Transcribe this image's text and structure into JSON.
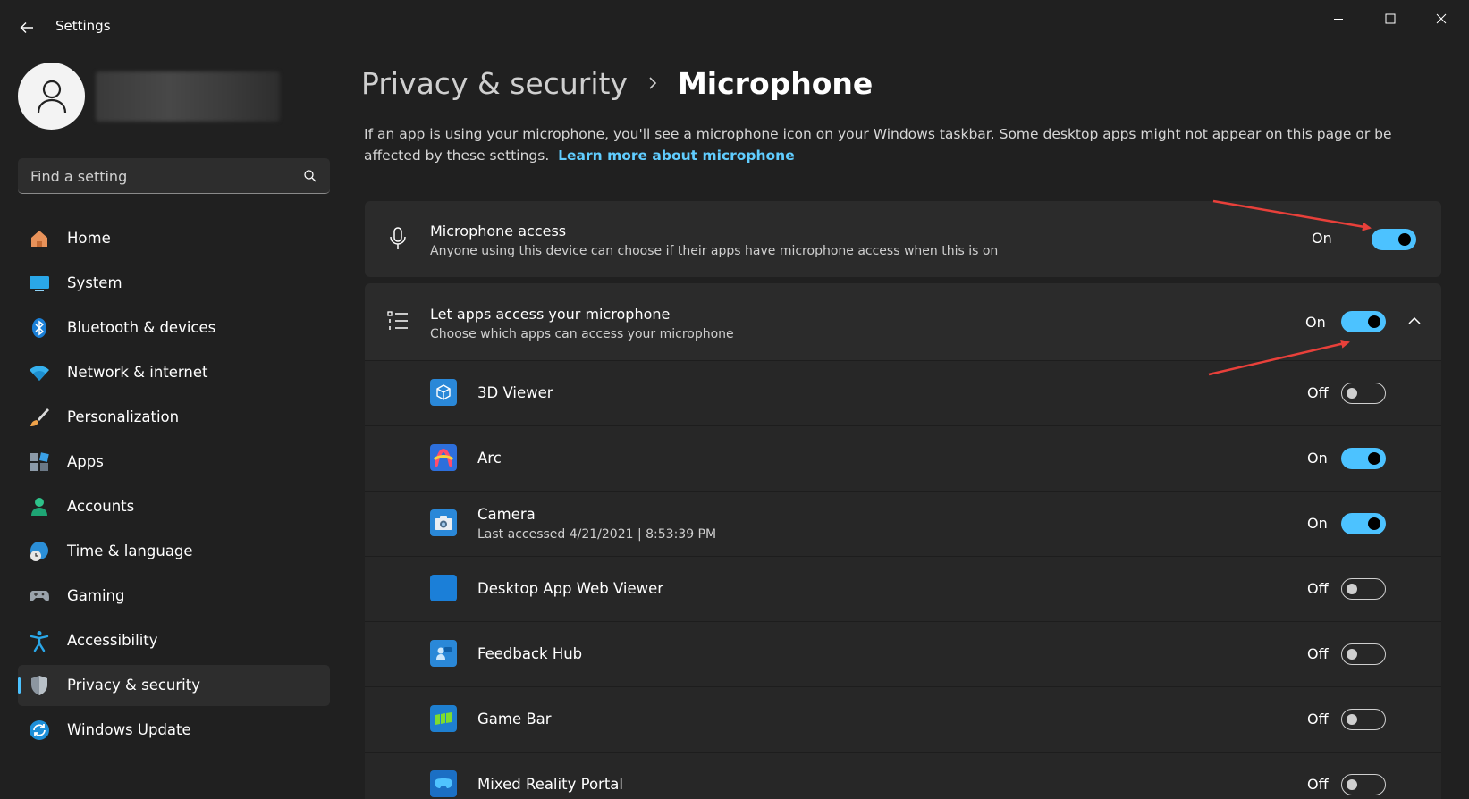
{
  "window": {
    "title": "Settings",
    "accent_color": "#4cc2ff",
    "link_color": "#60cdff"
  },
  "search": {
    "placeholder": "Find a setting"
  },
  "sidebar": {
    "items": [
      {
        "label": "Home",
        "icon": "home-icon"
      },
      {
        "label": "System",
        "icon": "system-icon"
      },
      {
        "label": "Bluetooth & devices",
        "icon": "bluetooth-icon"
      },
      {
        "label": "Network & internet",
        "icon": "wifi-icon"
      },
      {
        "label": "Personalization",
        "icon": "brush-icon"
      },
      {
        "label": "Apps",
        "icon": "apps-icon"
      },
      {
        "label": "Accounts",
        "icon": "account-icon"
      },
      {
        "label": "Time & language",
        "icon": "globe-clock-icon"
      },
      {
        "label": "Gaming",
        "icon": "controller-icon"
      },
      {
        "label": "Accessibility",
        "icon": "accessibility-icon"
      },
      {
        "label": "Privacy & security",
        "icon": "shield-icon",
        "active": true
      },
      {
        "label": "Windows Update",
        "icon": "update-icon"
      }
    ]
  },
  "breadcrumb": {
    "parent": "Privacy & security",
    "current": "Microphone"
  },
  "description": {
    "text": "If an app is using your microphone, you'll see a microphone icon on your Windows taskbar. Some desktop apps might not appear on this page or be affected by these settings.",
    "link": "Learn more about microphone"
  },
  "microphone_access": {
    "title": "Microphone access",
    "subtitle": "Anyone using this device can choose if their apps have microphone access when this is on",
    "state": "On",
    "enabled": true
  },
  "let_apps": {
    "title": "Let apps access your microphone",
    "subtitle": "Choose which apps can access your microphone",
    "state": "On",
    "enabled": true
  },
  "apps": [
    {
      "name": "3D Viewer",
      "state": "Off",
      "enabled": false,
      "icon": "3d-viewer-icon"
    },
    {
      "name": "Arc",
      "state": "On",
      "enabled": true,
      "icon": "arc-icon"
    },
    {
      "name": "Camera",
      "subtitle": "Last accessed 4/21/2021  |  8:53:39 PM",
      "state": "On",
      "enabled": true,
      "icon": "camera-icon"
    },
    {
      "name": "Desktop App Web Viewer",
      "state": "Off",
      "enabled": false,
      "icon": "web-viewer-icon"
    },
    {
      "name": "Feedback Hub",
      "state": "Off",
      "enabled": false,
      "icon": "feedback-hub-icon"
    },
    {
      "name": "Game Bar",
      "state": "Off",
      "enabled": false,
      "icon": "game-bar-icon"
    },
    {
      "name": "Mixed Reality Portal",
      "state": "Off",
      "enabled": false,
      "icon": "mixed-reality-icon"
    }
  ]
}
